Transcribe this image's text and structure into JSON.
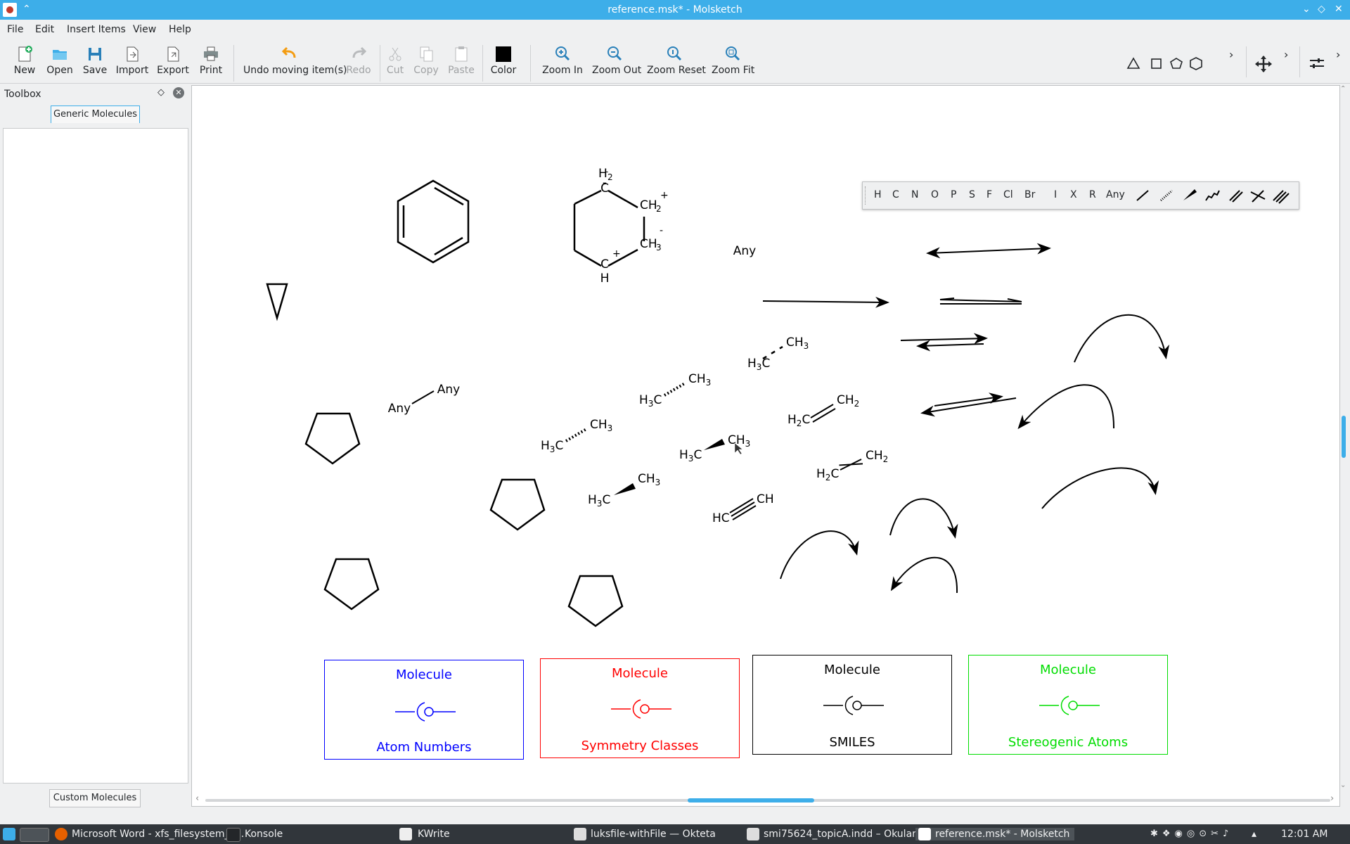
{
  "window": {
    "title": "reference.msk* - Molsketch"
  },
  "menubar": {
    "items": [
      "File",
      "Edit",
      "Insert Items",
      "View",
      "Help"
    ]
  },
  "toolbar": {
    "new": "New",
    "open": "Open",
    "save": "Save",
    "import": "Import",
    "export": "Export",
    "print": "Print",
    "undo": "Undo moving item(s)",
    "redo": "Redo",
    "cut": "Cut",
    "copy": "Copy",
    "paste": "Paste",
    "color": "Color",
    "zoom_in": "Zoom In",
    "zoom_out": "Zoom Out",
    "zoom_reset": "Zoom Reset",
    "zoom_fit": "Zoom Fit",
    "color_value": "#000000"
  },
  "toolbox": {
    "title": "Toolbox",
    "tab_top": "Generic Molecules",
    "tab_bottom": "Custom Molecules"
  },
  "element_bar": {
    "items": [
      "H",
      "C",
      "N",
      "O",
      "P",
      "S",
      "F",
      "Cl",
      "Br",
      "I",
      "X",
      "R",
      "Any"
    ]
  },
  "canvas": {
    "hex_labels": {
      "h2": "H",
      "h2sub": "2",
      "c_top": "C",
      "ch2": "CH",
      "ch2sub": "2",
      "ch3": "CH",
      "ch3sub": "3",
      "c_bot": "C",
      "h_bot": "H",
      "minus": "-",
      "plus": "+"
    },
    "any_single": "Any",
    "any_bond": [
      "Any",
      "Any"
    ],
    "ethanes": {
      "h3c": "H",
      "h3csub": "3",
      "ch3": "CH"
    },
    "ethenes": {
      "h2c": "H",
      "ch2": "CH"
    },
    "acetylene": [
      "HC",
      "CH"
    ],
    "boxes": [
      {
        "top": "Molecule",
        "bottom": "Atom Numbers",
        "color": "#0000ff"
      },
      {
        "top": "Molecule",
        "bottom": "Symmetry Classes",
        "color": "#ff0000"
      },
      {
        "top": "Molecule",
        "bottom": "SMILES",
        "color": "#000000"
      },
      {
        "top": "Molecule",
        "bottom": "Stereogenic Atoms",
        "color": "#00dd00"
      }
    ]
  },
  "taskbar": {
    "tasks": [
      "Microsoft Word - xfs_filesystem_s...",
      "Konsole",
      "KWrite",
      "luksfile-withFile  — Okteta",
      "smi75624_topicA.indd – Okular",
      "reference.msk* - Molsketch"
    ],
    "clock": "12:01 AM"
  }
}
